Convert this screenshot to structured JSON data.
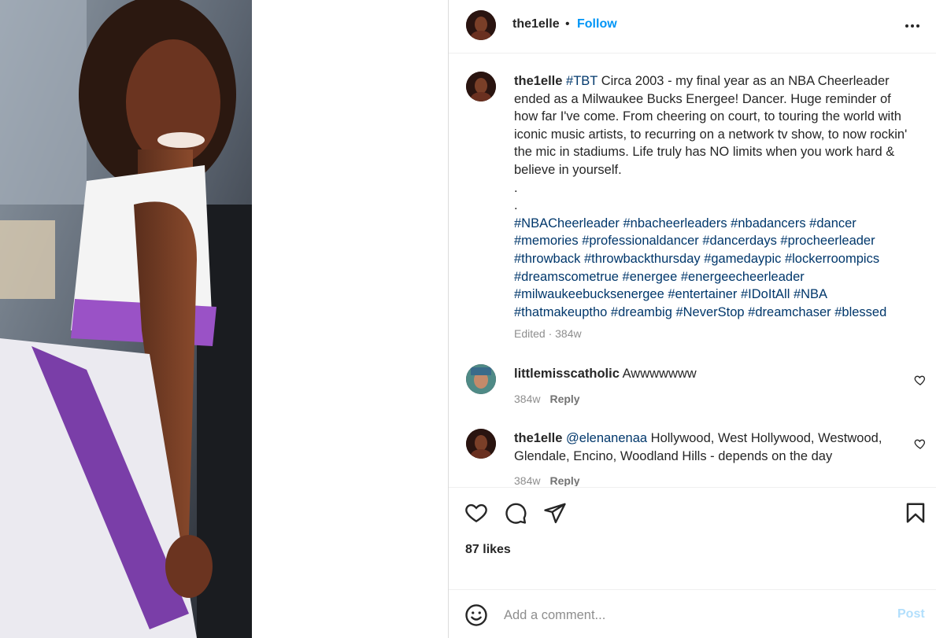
{
  "header": {
    "username": "the1elle",
    "dot": "•",
    "follow_label": "Follow",
    "more_icon": "more-horizontal-icon"
  },
  "caption": {
    "username": "the1elle",
    "hashtag_tbt": "#TBT",
    "text": "Circa 2003 - my final year as an NBA Cheerleader ended as a Milwaukee Bucks Energee! Dancer. Huge reminder of how far I've come. From cheering on court, to touring the world with iconic music artists, to recurring on a network tv show, to now rockin' the mic in stadiums. Life truly has NO limits when you work hard & believe in yourself.",
    "dot1": ".",
    "dot2": ".",
    "hashtags_line1": "#NBACheerleader #nbacheerleaders #nbadancers #dancer",
    "hashtags_line2": "#memories #professionaldancer #dancerdays #procheerleader",
    "hashtags_line3": "#throwback #throwbackthursday #gamedaypic #lockerroompics",
    "hashtags_line4": "#dreamscometrue #energee #energeecheerleader",
    "hashtags_line5": "#milwaukeebucksenergee #entertainer #IDoItAll #NBA",
    "hashtags_line6": "#thatmakeuptho #dreambig #NeverStop #dreamchaser #blessed",
    "meta": "Edited · 384w"
  },
  "comments": [
    {
      "username": "littlemisscatholic",
      "mention": "",
      "text": "Awwwwwww",
      "age": "384w",
      "reply_label": "Reply"
    },
    {
      "username": "the1elle",
      "mention": "@elenanenaa",
      "text": "Hollywood, West Hollywood, Westwood, Glendale, Encino, Woodland Hills - depends on the day",
      "age": "384w",
      "reply_label": "Reply"
    }
  ],
  "actions": {
    "like_icon": "heart-icon",
    "comment_icon": "comment-icon",
    "share_icon": "paper-plane-icon",
    "save_icon": "bookmark-icon",
    "likes_text": "87 likes"
  },
  "add_comment": {
    "placeholder": "Add a comment...",
    "post_label": "Post",
    "emoji_icon": "emoji-icon"
  },
  "colors": {
    "accent": "#0095f6",
    "link": "#00376b",
    "muted": "#8e8e8e",
    "post_disabled": "#b2dffc"
  }
}
